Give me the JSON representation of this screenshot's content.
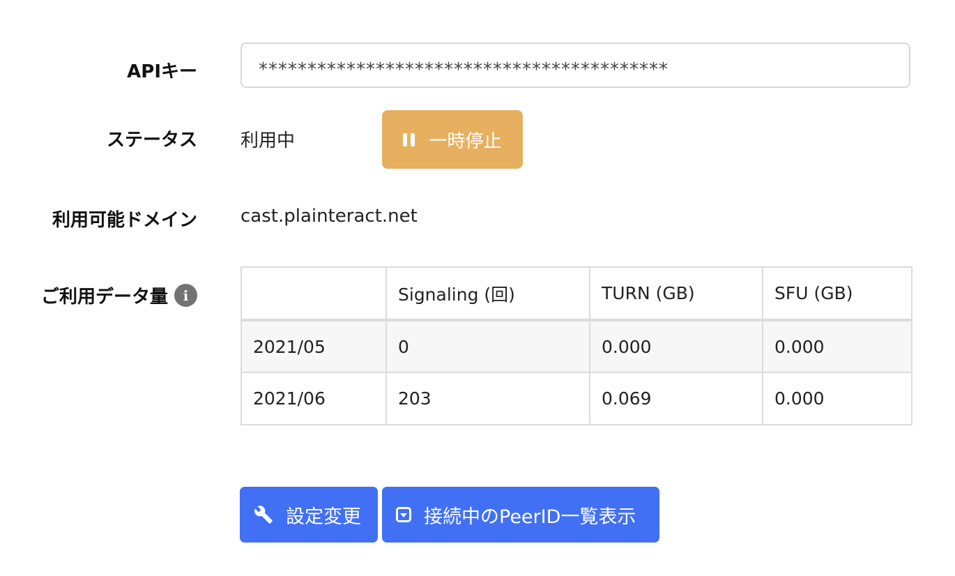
{
  "api_key": {
    "label": "APIキー",
    "value": "******************************************"
  },
  "status": {
    "label": "ステータス",
    "value": "利用中",
    "pause_button_label": "一時停止",
    "pause_button_color": "#e6b060"
  },
  "domain": {
    "label": "利用可能ドメイン",
    "value": "cast.plainteract.net"
  },
  "usage": {
    "label": "ご利用データ量",
    "info_icon_glyph": "i",
    "headers": [
      "",
      "Signaling (回)",
      "TURN (GB)",
      "SFU (GB)"
    ],
    "rows": [
      [
        "2021/05",
        "0",
        "0.000",
        "0.000"
      ],
      [
        "2021/06",
        "203",
        "0.069",
        "0.000"
      ]
    ]
  },
  "actions": {
    "settings_label": "設定変更",
    "peers_label": "接続中のPeerID一覧表示",
    "button_color": "#4170f5"
  }
}
